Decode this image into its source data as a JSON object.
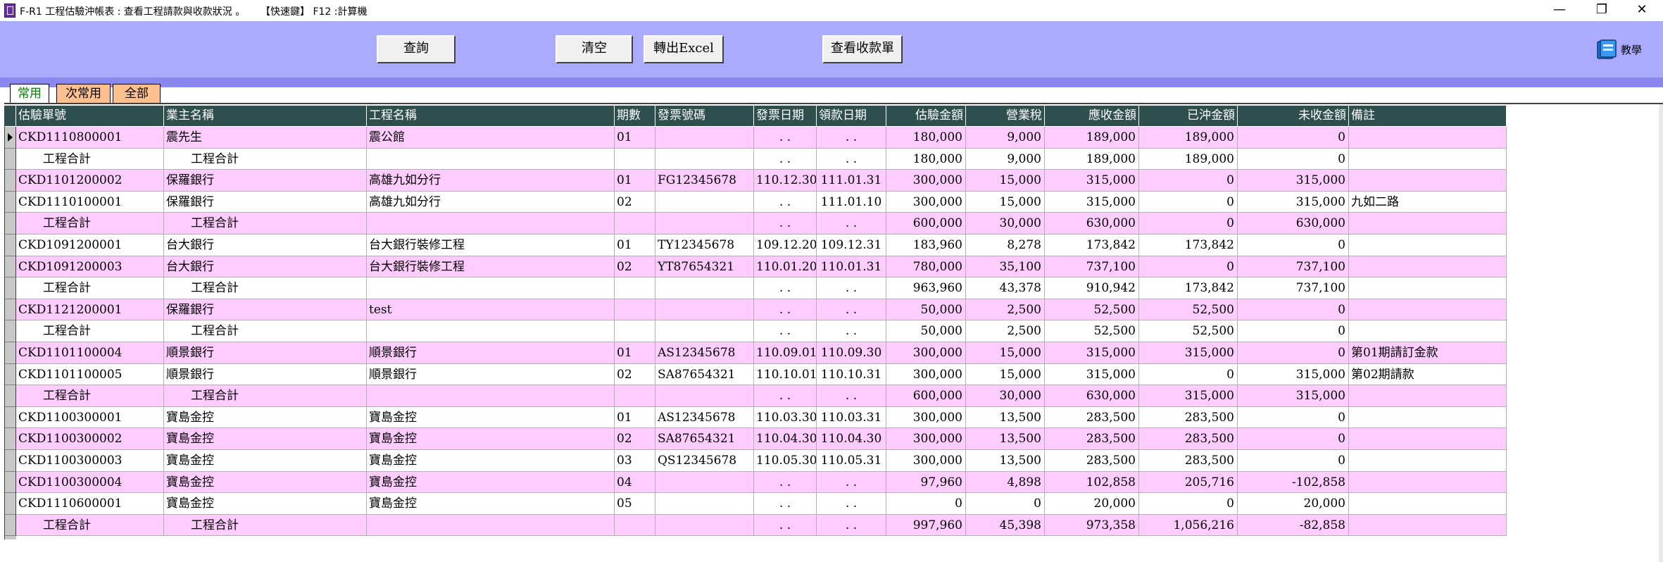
{
  "window": {
    "title": "F-R1 工程估驗沖帳表 : 查看工程請款與收款狀況 。",
    "hint": "【快速鍵】  F12 :計算機",
    "minimize": "—",
    "restore": "❐",
    "close": "✕"
  },
  "toolbar": {
    "query_label": "查詢",
    "clear_label": "清空",
    "export_label": "轉出Excel",
    "receipts_label": "查看收款單",
    "help_label": "教學",
    "help_icon": "tutorial-book-icon",
    "colors": {
      "toolbar_bg": "#aaaaff",
      "tab_strip": "#8888ee"
    }
  },
  "tabs": [
    {
      "label": "常用",
      "active": true
    },
    {
      "label": "次常用",
      "active": false
    },
    {
      "label": "全部",
      "active": false
    }
  ],
  "grid": {
    "columns": [
      "估驗單號",
      "業主名稱",
      "工程名稱",
      "期數",
      "發票號碼",
      "發票日期",
      "領款日期",
      "估驗金額",
      "營業稅",
      "應收金額",
      "已沖金額",
      "未收金額",
      "備註"
    ],
    "rows": [
      {
        "type": "pink",
        "selected": true,
        "cells": [
          "CKD1110800001",
          "震先生",
          "震公館",
          "01",
          "",
          " . .",
          " . .",
          "180,000",
          "9,000",
          "189,000",
          "189,000",
          "0",
          ""
        ]
      },
      {
        "type": "white",
        "subtotal": true,
        "cells": [
          "工程合計",
          "工程合計",
          "",
          "",
          "",
          " . .",
          " . .",
          "180,000",
          "9,000",
          "189,000",
          "189,000",
          "0",
          ""
        ]
      },
      {
        "type": "pink",
        "cells": [
          "CKD1101200002",
          "保羅銀行",
          "高雄九如分行",
          "01",
          "FG12345678",
          "110.12.30",
          "111.01.31",
          "300,000",
          "15,000",
          "315,000",
          "0",
          "315,000",
          ""
        ]
      },
      {
        "type": "white",
        "cells": [
          "CKD1110100001",
          "保羅銀行",
          "高雄九如分行",
          "02",
          "",
          " . .",
          "111.01.10",
          "300,000",
          "15,000",
          "315,000",
          "0",
          "315,000",
          "九如二路"
        ]
      },
      {
        "type": "pink",
        "subtotal": true,
        "cells": [
          "工程合計",
          "工程合計",
          "",
          "",
          "",
          " . .",
          " . .",
          "600,000",
          "30,000",
          "630,000",
          "0",
          "630,000",
          ""
        ]
      },
      {
        "type": "white",
        "cells": [
          "CKD1091200001",
          "台大銀行",
          "台大銀行裝修工程",
          "01",
          "TY12345678",
          "109.12.20",
          "109.12.31",
          "183,960",
          "8,278",
          "173,842",
          "173,842",
          "0",
          ""
        ]
      },
      {
        "type": "pink",
        "cells": [
          "CKD1091200003",
          "台大銀行",
          "台大銀行裝修工程",
          "02",
          "YT87654321",
          "110.01.20",
          "110.01.31",
          "780,000",
          "35,100",
          "737,100",
          "0",
          "737,100",
          ""
        ]
      },
      {
        "type": "white",
        "subtotal": true,
        "cells": [
          "工程合計",
          "工程合計",
          "",
          "",
          "",
          " . .",
          " . .",
          "963,960",
          "43,378",
          "910,942",
          "173,842",
          "737,100",
          ""
        ]
      },
      {
        "type": "pink",
        "cells": [
          "CKD1121200001",
          "保羅銀行",
          "test",
          "",
          "",
          " . .",
          " . .",
          "50,000",
          "2,500",
          "52,500",
          "52,500",
          "0",
          ""
        ]
      },
      {
        "type": "white",
        "subtotal": true,
        "cells": [
          "工程合計",
          "工程合計",
          "",
          "",
          "",
          " . .",
          " . .",
          "50,000",
          "2,500",
          "52,500",
          "52,500",
          "0",
          ""
        ]
      },
      {
        "type": "pink",
        "cells": [
          "CKD1101100004",
          "順景銀行",
          "順景銀行",
          "01",
          "AS12345678",
          "110.09.01",
          "110.09.30",
          "300,000",
          "15,000",
          "315,000",
          "315,000",
          "0",
          "第01期請訂金款"
        ]
      },
      {
        "type": "white",
        "cells": [
          "CKD1101100005",
          "順景銀行",
          "順景銀行",
          "02",
          "SA87654321",
          "110.10.01",
          "110.10.31",
          "300,000",
          "15,000",
          "315,000",
          "0",
          "315,000",
          "第02期請款"
        ]
      },
      {
        "type": "pink",
        "subtotal": true,
        "cells": [
          "工程合計",
          "工程合計",
          "",
          "",
          "",
          " . .",
          " . .",
          "600,000",
          "30,000",
          "630,000",
          "315,000",
          "315,000",
          ""
        ]
      },
      {
        "type": "white",
        "cells": [
          "CKD1100300001",
          "寶島金控",
          "寶島金控",
          "01",
          "AS12345678",
          "110.03.30",
          "110.03.31",
          "300,000",
          "13,500",
          "283,500",
          "283,500",
          "0",
          ""
        ]
      },
      {
        "type": "pink",
        "cells": [
          "CKD1100300002",
          "寶島金控",
          "寶島金控",
          "02",
          "SA87654321",
          "110.04.30",
          "110.04.30",
          "300,000",
          "13,500",
          "283,500",
          "283,500",
          "0",
          ""
        ]
      },
      {
        "type": "white",
        "cells": [
          "CKD1100300003",
          "寶島金控",
          "寶島金控",
          "03",
          "QS12345678",
          "110.05.30",
          "110.05.31",
          "300,000",
          "13,500",
          "283,500",
          "283,500",
          "0",
          ""
        ]
      },
      {
        "type": "pink",
        "cells": [
          "CKD1100300004",
          "寶島金控",
          "寶島金控",
          "04",
          "",
          " . .",
          " . .",
          "97,960",
          "4,898",
          "102,858",
          "205,716",
          "-102,858",
          ""
        ]
      },
      {
        "type": "white",
        "cells": [
          "CKD1110600001",
          "寶島金控",
          "寶島金控",
          "05",
          "",
          " . .",
          " . .",
          "0",
          "0",
          "20,000",
          "0",
          "20,000",
          ""
        ]
      },
      {
        "type": "pink",
        "subtotal": true,
        "cells": [
          "工程合計",
          "工程合計",
          "",
          "",
          "",
          " . .",
          " . .",
          "997,960",
          "45,398",
          "973,358",
          "1,056,216",
          "-82,858",
          ""
        ]
      }
    ]
  }
}
